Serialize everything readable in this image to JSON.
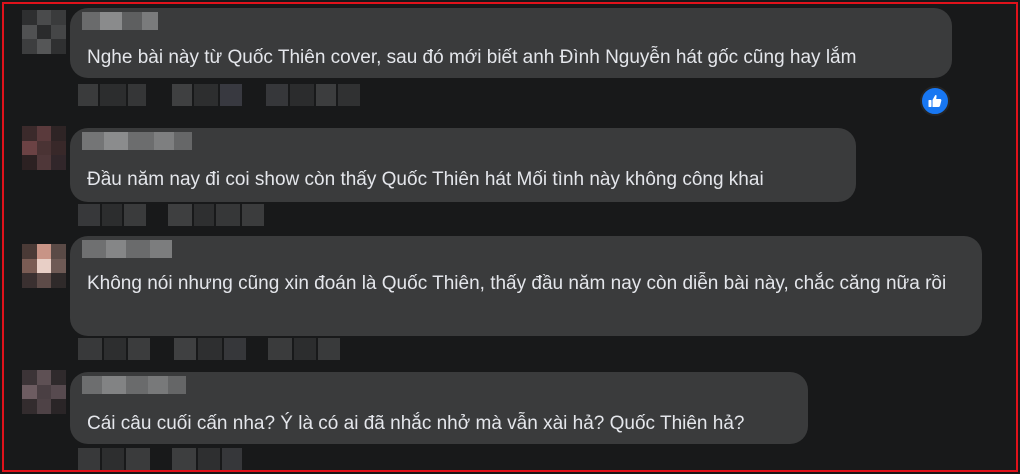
{
  "comments": [
    {
      "text": "Nghe bài này từ Quốc Thiên cover, sau đó mới biết anh Đình Nguyễn hát gốc cũng hay lắm",
      "reaction": "like"
    },
    {
      "text": "Đầu năm nay đi coi show còn thấy Quốc Thiên hát Mối tình này không công khai"
    },
    {
      "text": "Không nói nhưng cũng xin đoán là Quốc Thiên, thấy đầu năm nay còn diễn bài này, chắc căng nữa rồi"
    },
    {
      "text": "Cái câu cuối cấn nha? Ý là có ai đã nhắc nhở mà vẫn xài hả? Quốc Thiên hả?"
    }
  ],
  "colors": {
    "accent": "#1877f2",
    "frame_border": "#e0121b",
    "bubble": "#3a3b3c",
    "background": "#18191a",
    "text": "#e4e6eb"
  },
  "icons": {
    "reaction": "thumbs-up-icon"
  }
}
